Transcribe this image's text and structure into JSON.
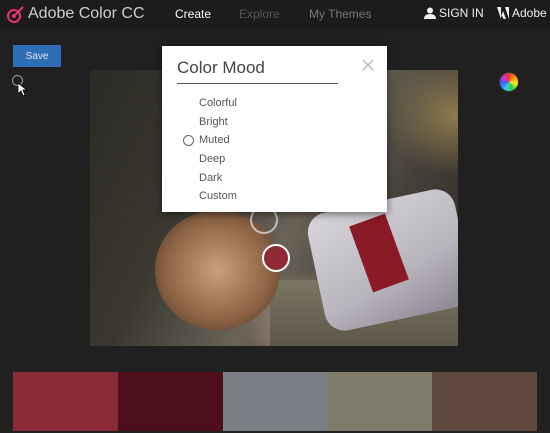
{
  "header": {
    "app_title": "Adobe Color CC",
    "nav": [
      "Create",
      "Explore",
      "My Themes"
    ],
    "sign_in": "SIGN IN",
    "adobe": "Adobe"
  },
  "toolbar": {
    "save_label": "Save"
  },
  "modal": {
    "title": "Color Mood",
    "options": [
      "Colorful",
      "Bright",
      "Muted",
      "Deep",
      "Dark",
      "Custom"
    ],
    "selected": "Muted"
  },
  "palette": {
    "colors": [
      "#8a2a36",
      "#4e0f1c",
      "#7c7e86",
      "#7e7b6a",
      "#5e4840"
    ]
  },
  "colors": {
    "accent": "#2f6eb4",
    "background": "#202020"
  }
}
